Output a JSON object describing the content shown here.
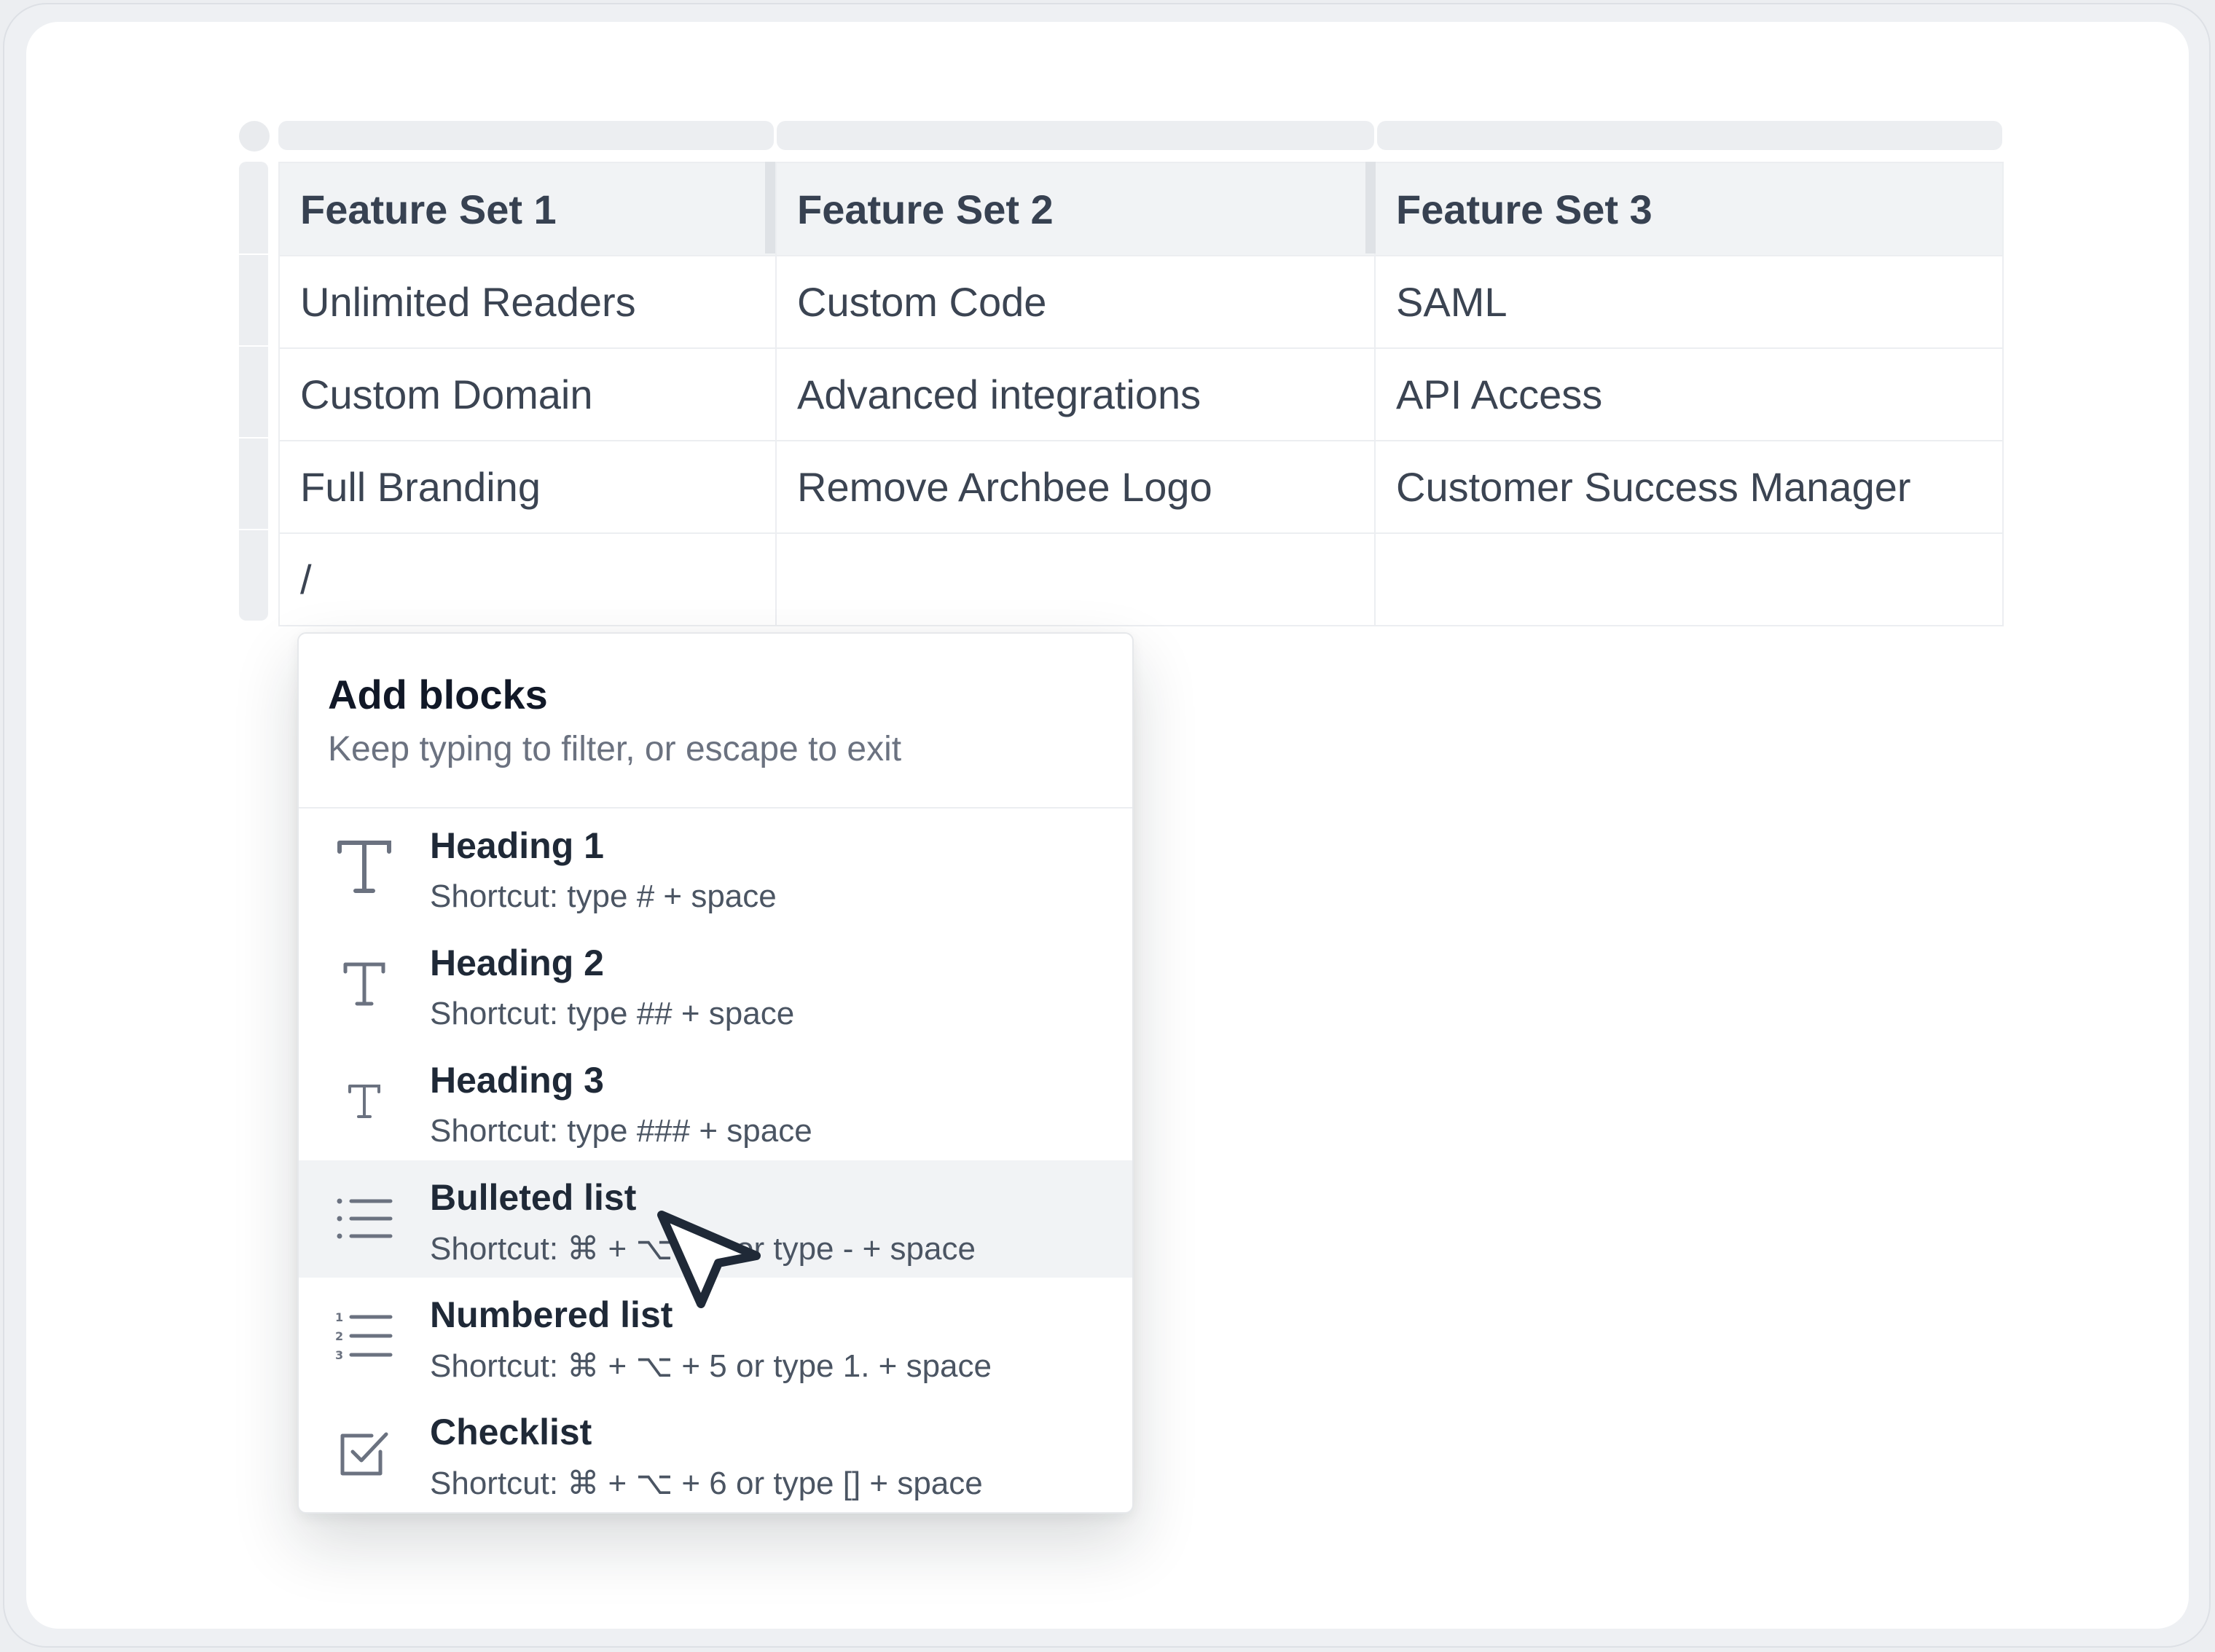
{
  "table": {
    "headers": [
      "Feature Set 1",
      "Feature Set 2",
      "Feature Set 3"
    ],
    "rows": [
      [
        "Unlimited Readers",
        "Custom Code",
        "SAML"
      ],
      [
        "Custom Domain",
        "Advanced integrations",
        "API Access"
      ],
      [
        "Full Branding",
        "Remove Archbee Logo",
        "Customer Success Manager"
      ],
      [
        "/",
        "",
        ""
      ]
    ]
  },
  "menu": {
    "title": "Add blocks",
    "subtitle": "Keep typing to filter, or escape to exit",
    "items": [
      {
        "icon": "heading-1-icon",
        "label": "Heading 1",
        "shortcut": "Shortcut: type # + space"
      },
      {
        "icon": "heading-2-icon",
        "label": "Heading 2",
        "shortcut": "Shortcut: type ## + space"
      },
      {
        "icon": "heading-3-icon",
        "label": "Heading 3",
        "shortcut": "Shortcut: type ### + space"
      },
      {
        "icon": "bulleted-list-icon",
        "label": "Bulleted list",
        "shortcut": "Shortcut: ⌘ + ⌥ + 4 or type - + space"
      },
      {
        "icon": "numbered-list-icon",
        "label": "Numbered list",
        "shortcut": "Shortcut: ⌘ + ⌥ + 5 or type 1. + space"
      },
      {
        "icon": "checklist-icon",
        "label": "Checklist",
        "shortcut": "Shortcut: ⌘ + ⌥ + 6 or type [] + space"
      }
    ],
    "highlighted_item": "Bulleted list"
  },
  "colors": {
    "text": "#3b4452",
    "header_bg": "#f1f3f5",
    "hover_bg": "#f1f3f5",
    "icon": "#6b7280"
  }
}
